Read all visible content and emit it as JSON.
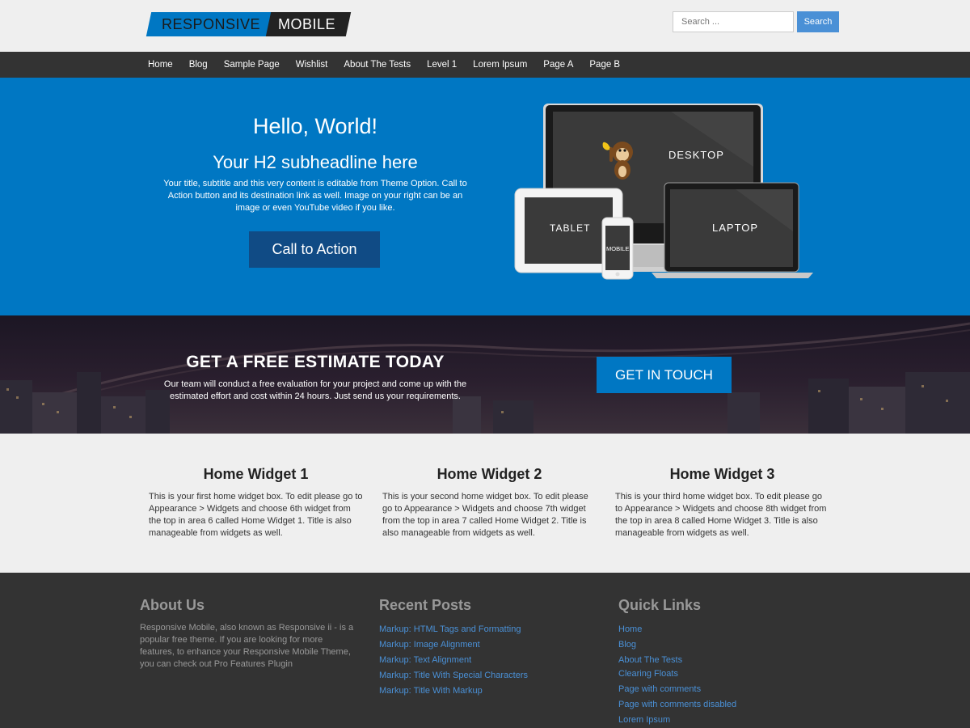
{
  "header": {
    "logo_part1": "RESPONSIVE",
    "logo_part2": "MOBILE",
    "search_placeholder": "Search ...",
    "search_button": "Search"
  },
  "nav": {
    "items": [
      "Home",
      "Blog",
      "Sample Page",
      "Wishlist",
      "About The Tests",
      "Level 1",
      "Lorem Ipsum",
      "Page A",
      "Page B"
    ]
  },
  "hero": {
    "title": "Hello, World!",
    "subtitle": "Your H2 subheadline here",
    "text": "Your title, subtitle and this very content is editable from Theme Option. Call to Action button and its destination link as well. Image on your right can be an image or even YouTube video if you like.",
    "cta": "Call to Action",
    "device_labels": {
      "desktop": "DESKTOP",
      "tablet": "TABLET",
      "mobile": "MOBILE",
      "laptop": "LAPTOP"
    }
  },
  "estimate": {
    "title": "GET A FREE ESTIMATE TODAY",
    "text": "Our team will conduct a free evaluation for your project and come up with the estimated effort and cost within 24 hours. Just send us your requirements.",
    "button": "GET IN TOUCH"
  },
  "widgets": [
    {
      "title": "Home Widget 1",
      "text": "This is your first home widget box. To edit please go to Appearance > Widgets and choose 6th widget from the top in area 6 called Home Widget 1. Title is also manageable from widgets as well."
    },
    {
      "title": "Home Widget 2",
      "text": "This is your second home widget box. To edit please go to Appearance > Widgets and choose 7th widget from the top in area 7 called Home Widget 2. Title is also manageable from widgets as well."
    },
    {
      "title": "Home Widget 3",
      "text": "This is your third home widget box. To edit please go to Appearance > Widgets and choose 8th widget from the top in area 8 called Home Widget 3. Title is also manageable from widgets as well."
    }
  ],
  "footer": {
    "about": {
      "title": "About Us",
      "text": "Responsive Mobile, also known as Responsive ii - is a popular free theme. If you are looking for more features, to enhance your Responsive Mobile Theme, you can check out Pro Features Plugin"
    },
    "recent_posts": {
      "title": "Recent Posts",
      "items": [
        "Markup: HTML Tags and Formatting",
        "Markup: Image Alignment",
        "Markup: Text Alignment",
        "Markup: Title With Special Characters",
        "Markup: Title With Markup"
      ]
    },
    "quick_links": {
      "title": "Quick Links",
      "items": [
        "Home",
        "Blog",
        "About The Tests",
        "Clearing Floats",
        "Page with comments",
        "Page with comments disabled",
        "Lorem Ipsum"
      ]
    }
  },
  "colors": {
    "accent_blue": "#0077c3",
    "dark_blue": "#104b85",
    "nav_bg": "#333333",
    "link_blue": "#4a90d6"
  }
}
